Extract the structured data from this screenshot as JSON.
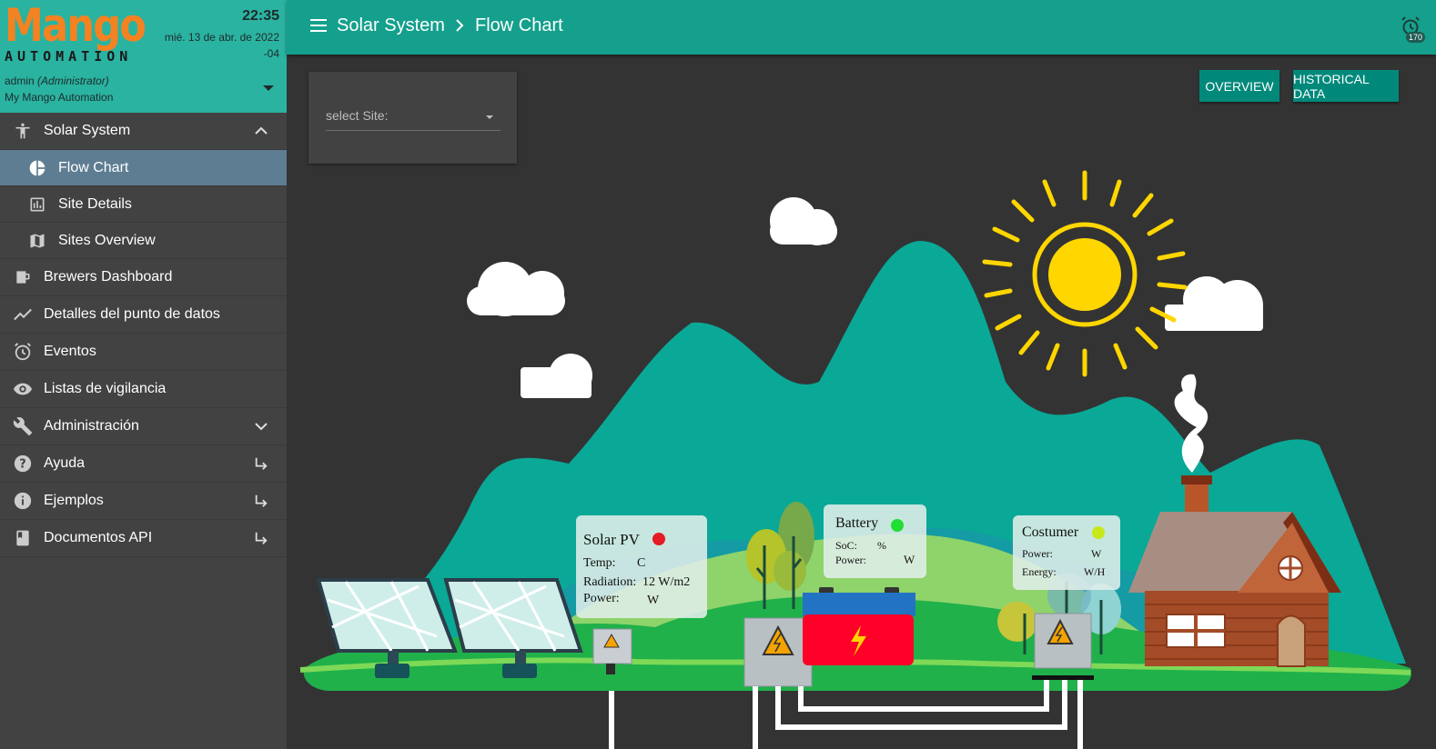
{
  "brand": {
    "name": "Mango",
    "tagline": "AUTOMATION"
  },
  "clock": {
    "time": "22:35",
    "date": "mié. 13 de abr. de 2022",
    "tz": "-04"
  },
  "user": {
    "name": "admin",
    "role": "(Administrator)",
    "subtitle": "My Mango Automation"
  },
  "menu": {
    "solar": "Solar System",
    "flow": "Flow Chart",
    "site_details": "Site Details",
    "sites_overview": "Sites Overview",
    "brewers": "Brewers Dashboard",
    "detalles": "Detalles del punto de datos",
    "eventos": "Eventos",
    "listas": "Listas de vigilancia",
    "admin": "Administración",
    "ayuda": "Ayuda",
    "ejemplos": "Ejemplos",
    "docs": "Documentos API"
  },
  "header": {
    "crumb1": "Solar System",
    "crumb2": "Flow Chart",
    "alarm_count": "170"
  },
  "controls": {
    "site_placeholder": "select Site:",
    "overview": "OVERVIEW",
    "historical": "HISTORICAL DATA"
  },
  "colors": {
    "sidebar_header": "#2ab3a1",
    "topbar": "#14a08c",
    "active_item": "#5e7d92",
    "button": "#00897b",
    "mountain": "#0aa896",
    "grass": "#5cc04f",
    "sun": "#ffd600"
  },
  "solar": {
    "title": "Solar PV",
    "status": "#e51c23",
    "temp_label": "Temp:",
    "temp_unit": "C",
    "rad_label": "Radiation:",
    "rad_value": "12 W/m2",
    "power_label": "Power:",
    "power_unit": "W"
  },
  "battery": {
    "title": "Battery",
    "status": "#22dd33",
    "soc_label": "SoC:",
    "soc_unit": "%",
    "power_label": "Power:",
    "power_unit": "W"
  },
  "consumer": {
    "title": "Costumer",
    "status": "#c8e81a",
    "power_label": "Power:",
    "power_unit": "W",
    "energy_label": "Energy:",
    "energy_unit": "W/H"
  }
}
